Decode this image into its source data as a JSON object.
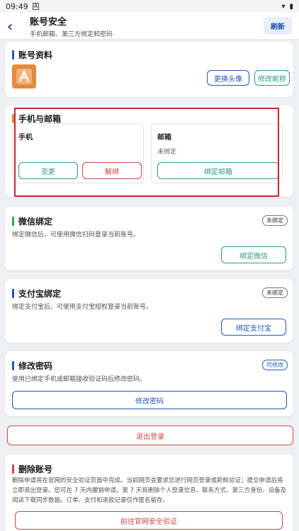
{
  "status_bar": {
    "time": "09:49",
    "a_icon": "A"
  },
  "appbar": {
    "title": "账号安全",
    "subtitle": "手机邮箱、第三方绑定和密码",
    "refresh": "刷新"
  },
  "profile": {
    "title": "账号资料",
    "change_avatar": "更换头像",
    "change_nickname": "修改昵称"
  },
  "phone_email": {
    "title": "手机与邮箱",
    "phone": {
      "label": "手机",
      "value": "",
      "change": "变更",
      "unbind": "解绑"
    },
    "email": {
      "label": "邮箱",
      "value": "未绑定",
      "bind": "绑定邮箱"
    }
  },
  "wechat": {
    "title": "微信绑定",
    "badge": "未绑定",
    "desc": "绑定微信后，可使用微信扫码登录当前账号。",
    "button": "绑定微信"
  },
  "alipay": {
    "title": "支付宝绑定",
    "badge": "未绑定",
    "desc": "绑定支付宝后，可使用支付宝授权登录当前账号。",
    "button": "绑定支付宝"
  },
  "password": {
    "title": "修改密码",
    "badge": "可修改",
    "desc": "使用已绑定手机或邮箱接收验证码后修改密码。",
    "button": "修改密码"
  },
  "logout": {
    "label": "退出登录"
  },
  "delete": {
    "title": "删除账号",
    "desc": "删除申请将在官网的安全验证页面中完成。当前网页会要求您进行网页登录或新鲜验证；提交申请后将立即退出登录。您可在 7 天内撤销申请，第 7 天将删除个人登录信息、联系方式、第三方身份、设备及阅读下载同步数据。订单、支付和退款记录仅作匿名留存。",
    "button": "前往官网安全验证"
  },
  "colors": {
    "accent_blue": "#2458b8",
    "accent_green": "#2e9a8a",
    "danger": "#d64545",
    "highlight": "#c8282f"
  }
}
